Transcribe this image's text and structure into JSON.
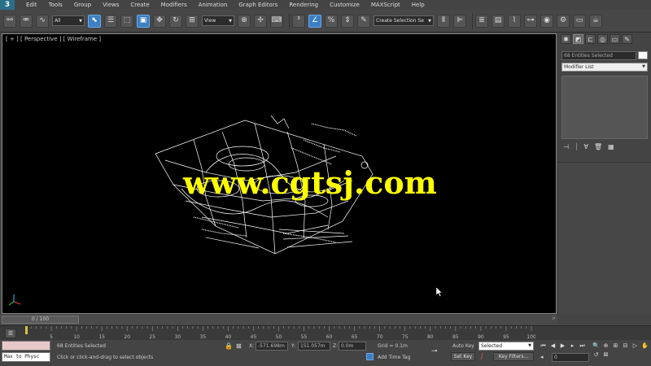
{
  "menu": {
    "logo": "3",
    "items": [
      "Edit",
      "Tools",
      "Group",
      "Views",
      "Create",
      "Modifiers",
      "Animation",
      "Graph Editors",
      "Rendering",
      "Customize",
      "MAXScript",
      "Help"
    ]
  },
  "toolbar": {
    "selection_filter": "All",
    "reference_coord": "View",
    "named_selection": "Create Selection Se"
  },
  "viewport": {
    "label": "[ + ] [ Perspective ] [ Wireframe ]",
    "watermark": "www.cgtsj.com"
  },
  "command_panel": {
    "selection_name": "68 Entities Selected",
    "modifier_list": "Modifier List"
  },
  "time_slider": {
    "position_label": "0 / 100",
    "prev_arrow": "<",
    "next_arrow": ">"
  },
  "trackbar": {
    "ticks": [
      "0",
      "5",
      "10",
      "15",
      "20",
      "25",
      "30",
      "35",
      "40",
      "45",
      "50",
      "55",
      "60",
      "65",
      "70",
      "75",
      "80",
      "85",
      "90",
      "95",
      "100"
    ]
  },
  "status": {
    "listener_text": "Max to Physc",
    "selection_status": "68 Entities Selected",
    "prompt": "Click or click-and-drag to select objects",
    "x_label": "X:",
    "x_value": "-571.698m",
    "y_label": "Y:",
    "y_value": "151.057m",
    "z_label": "Z:",
    "z_value": "0.0m",
    "grid": "Grid = 0.1m",
    "add_time_tag": "Add Time Tag",
    "auto_key": "Auto Key",
    "set_key": "Set Key",
    "key_mode": "Selected",
    "key_filters": "Key Filters...",
    "frame": "0"
  },
  "colors": {
    "watermark": "#ffff00",
    "viewport_bg": "#000000",
    "active_tool": "#3d7fc4"
  }
}
